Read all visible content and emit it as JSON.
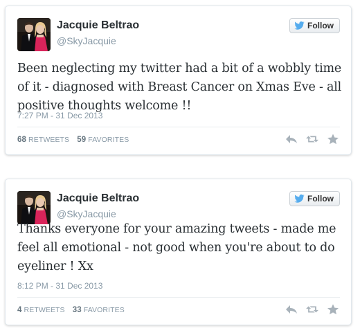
{
  "colors": {
    "twitter_blue": "#55acee",
    "name_text": "#292f33",
    "muted_text": "#8899a6",
    "icon_gray": "#a8b2ba"
  },
  "tweets": [
    {
      "author_name": "Jacquie Beltrao",
      "handle": "@SkyJacquie",
      "follow_label": "Follow",
      "text": "Been neglecting my twitter had a bit of a wobbly time of it - diagnosed with Breast Cancer on Xmas Eve - all positive thoughts welcome !!",
      "timestamp": "7:27 PM - 31 Dec 2013",
      "retweets_count": "68",
      "retweets_label": "RETWEETS",
      "favorites_count": "59",
      "favorites_label": "FAVORITES",
      "icons": [
        "reply-icon",
        "retweet-icon",
        "favorite-icon"
      ]
    },
    {
      "author_name": "Jacquie Beltrao",
      "handle": "@SkyJacquie",
      "follow_label": "Follow",
      "text": "Thanks everyone for your amazing tweets - made me feel all emotional - not good when you're about to do eyeliner ! Xx",
      "timestamp": "8:12 PM - 31 Dec 2013",
      "retweets_count": "4",
      "retweets_label": "RETWEETS",
      "favorites_count": "33",
      "favorites_label": "FAVORITES",
      "icons": [
        "reply-icon",
        "retweet-icon",
        "favorite-icon"
      ]
    }
  ]
}
